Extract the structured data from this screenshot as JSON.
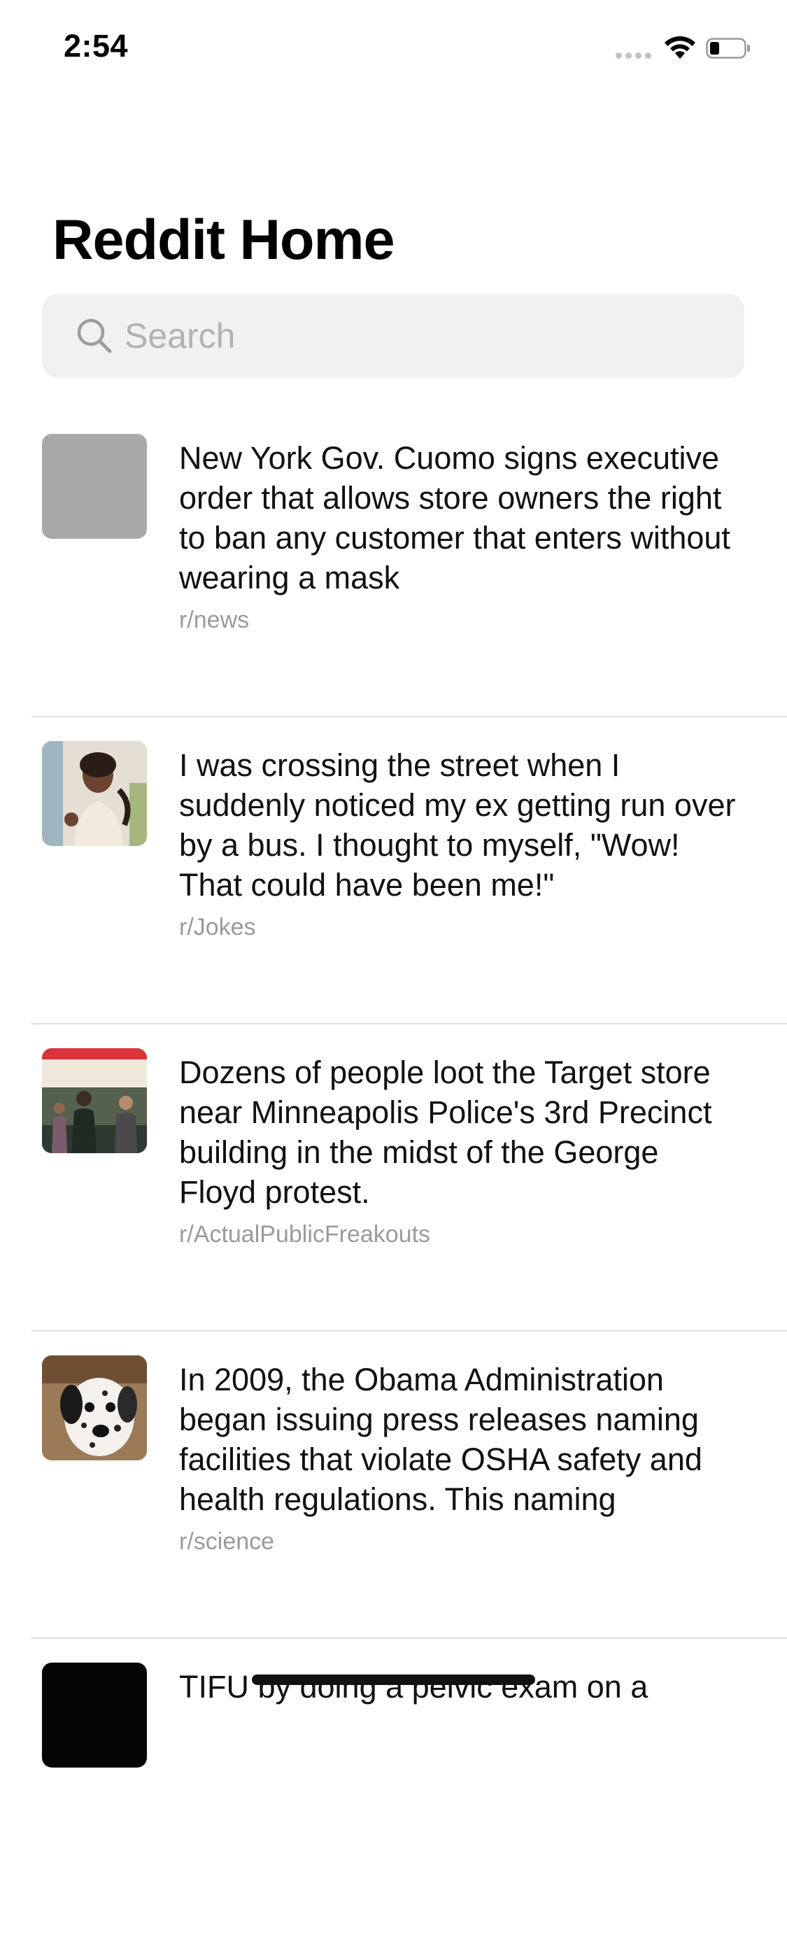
{
  "status_bar": {
    "time": "2:54"
  },
  "header": {
    "title": "Reddit Home"
  },
  "search": {
    "placeholder": "Search",
    "value": ""
  },
  "posts": [
    {
      "title": "New York Gov. Cuomo signs executive order that allows store owners the right to ban any customer that enters without wearing a mask",
      "subreddit": "r/news",
      "thumbnail": "placeholder"
    },
    {
      "title": "I was crossing the street when I suddenly noticed my ex getting run over by a bus. I thought to myself, \"Wow! That could have been me!\"",
      "subreddit": "r/Jokes",
      "thumbnail": "girl-photo"
    },
    {
      "title": "Dozens of people loot the Target store near Minneapolis Police's 3rd Precinct building in the midst of the George Floyd protest.",
      "subreddit": "r/ActualPublicFreakouts",
      "thumbnail": "store-photo"
    },
    {
      "title": "In 2009, the Obama Administration began issuing press releases naming facilities that violate OSHA safety and health regulations. This naming",
      "subreddit": "r/science",
      "thumbnail": "dalmatian-photo"
    },
    {
      "title": "TIFU by doing a pelvic exam on a",
      "subreddit": "",
      "thumbnail": "black"
    }
  ],
  "colors": {
    "search_background": "#f1f1f1",
    "placeholder_text": "#b2b2b2",
    "subreddit_text": "#9a9a9a",
    "divider": "#dedede"
  }
}
